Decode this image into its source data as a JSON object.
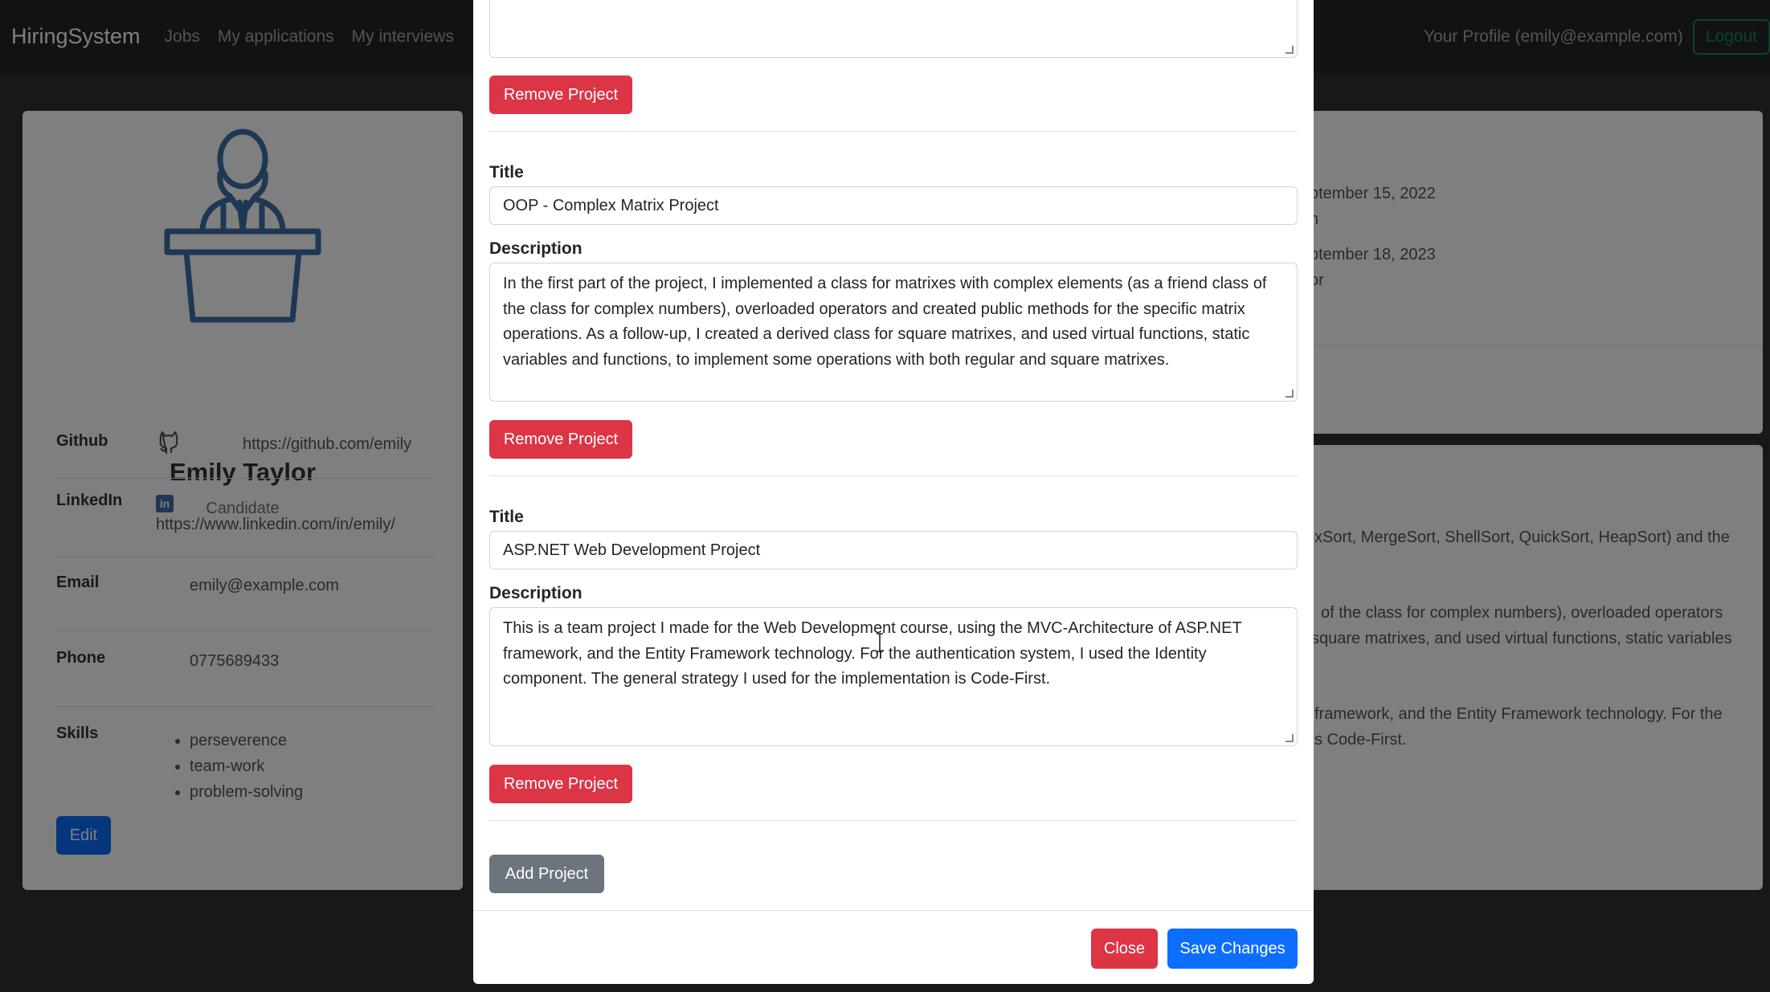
{
  "navbar": {
    "brand": "HiringSystem",
    "links": [
      "Jobs",
      "My applications",
      "My interviews"
    ],
    "profile": "Your Profile (emily@example.com)",
    "logout": "Logout"
  },
  "profile_card": {
    "name": "Emily Taylor",
    "role": "Candidate",
    "github_label": "Github",
    "github_url": "https://github.com/emily",
    "linkedin_label": "LinkedIn",
    "linkedin_url": "https://www.linkedin.com/in/emily/",
    "email_label": "Email",
    "email": "emily@example.com",
    "phone_label": "Phone",
    "phone": "0775689433",
    "skills_label": "Skills",
    "skills": [
      "perseverence",
      "team-work",
      "problem-solving"
    ],
    "edit_label": "Edit"
  },
  "right_card": {
    "date1": "ptember 15, 2022",
    "sub1": "n",
    "date2": "ptember 18, 2023",
    "sub2": "or",
    "line1": "xSort, MergeSort, ShellSort, QuickSort, HeapSort) and the",
    "line2": "of the class for complex numbers), overloaded operators",
    "line3": "square matrixes, and used virtual functions, static variables",
    "line4": "framework, and the Entity Framework technology. For the",
    "line5": "s Code-First."
  },
  "modal": {
    "projects": [
      {
        "title_label": "Title",
        "title": "OOP - Complex Matrix Project",
        "description_label": "Description",
        "description": "In the first part of the project, I implemented a class for matrixes with complex elements (as a friend class of the class for complex numbers), overloaded operators and created public methods for the specific matrix operations. As a follow-up, I created a derived class for square matrixes, and used virtual functions, static variables and functions, to implement some operations with both regular and square matrixes."
      },
      {
        "title_label": "Title",
        "title": "ASP.NET Web Development Project",
        "description_label": "Description",
        "description": "This is a team project I made for the Web Development course, using the MVC-Architecture of ASP.NET framework, and the Entity Framework technology. For the authentication system, I used the Identity component. The general strategy I used for the implementation is Code-First."
      }
    ],
    "remove_label": "Remove Project",
    "add_label": "Add Project",
    "close_label": "Close",
    "save_label": "Save Changes"
  },
  "icons": {
    "avatar": "podium-speaker-icon",
    "github": "github-icon",
    "linkedin": "linkedin-icon",
    "cursor": "text-cursor-icon"
  },
  "colors": {
    "primary": "#0d6efd",
    "danger": "#dc3545",
    "secondary": "#6c757d",
    "navbar": "#212529",
    "accent_icon": "#3d6fa6"
  }
}
